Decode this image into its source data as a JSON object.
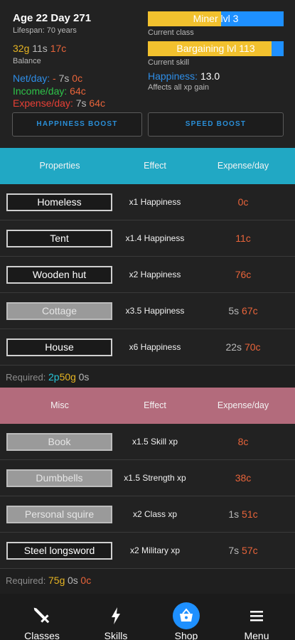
{
  "header": {
    "age": "Age 22 Day 271",
    "lifespan": "Lifespan: 70 years",
    "balance": {
      "gold": "32g",
      "silver": "11s",
      "copper": "17c"
    },
    "balance_label": "Balance",
    "net": {
      "label": "Net/day:",
      "sign": "-",
      "silver": "7s",
      "copper": "0c"
    },
    "income": {
      "label": "Income/day:",
      "copper": "64c"
    },
    "expense": {
      "label": "Expense/day:",
      "silver": "7s",
      "copper": "64c"
    },
    "class_bar": {
      "text": "Miner lvl 3",
      "progress": 0.54
    },
    "class_label": "Current class",
    "skill_bar": {
      "text": "Bargaining lvl 113",
      "progress": 0.91
    },
    "skill_label": "Current skill",
    "happiness": {
      "label": "Happiness:",
      "value": "13.0"
    },
    "happiness_note": "Affects all xp gain",
    "happiness_boost": "HAPPINESS BOOST",
    "speed_boost": "SPEED BOOST"
  },
  "properties": {
    "headers": {
      "name": "Properties",
      "effect": "Effect",
      "expense": "Expense/day"
    },
    "rows": [
      {
        "name": "Homeless",
        "effect": "x1 Happiness",
        "silver": "",
        "copper": "0c",
        "owned": false
      },
      {
        "name": "Tent",
        "effect": "x1.4 Happiness",
        "silver": "",
        "copper": "11c",
        "owned": false
      },
      {
        "name": "Wooden hut",
        "effect": "x2 Happiness",
        "silver": "",
        "copper": "76c",
        "owned": false
      },
      {
        "name": "Cottage",
        "effect": "x3.5 Happiness",
        "silver": "5s",
        "copper": "67c",
        "owned": true
      },
      {
        "name": "House",
        "effect": "x6 Happiness",
        "silver": "22s",
        "copper": "70c",
        "owned": false
      }
    ],
    "required": {
      "label": "Required:",
      "p": "2p",
      "gold": "50g",
      "silver": "0s"
    }
  },
  "misc": {
    "headers": {
      "name": "Misc",
      "effect": "Effect",
      "expense": "Expense/day"
    },
    "rows": [
      {
        "name": "Book",
        "effect": "x1.5 Skill xp",
        "silver": "",
        "copper": "8c",
        "owned": true
      },
      {
        "name": "Dumbbells",
        "effect": "x1.5 Strength xp",
        "silver": "",
        "copper": "38c",
        "owned": true
      },
      {
        "name": "Personal squire",
        "effect": "x2 Class xp",
        "silver": "1s",
        "copper": "51c",
        "owned": true
      },
      {
        "name": "Steel longsword",
        "effect": "x2 Military xp",
        "silver": "7s",
        "copper": "57c",
        "owned": false
      }
    ],
    "required": {
      "label": "Required:",
      "gold": "75g",
      "silver": "0s",
      "copper": "0c"
    }
  },
  "nav": {
    "items": [
      {
        "label": "Classes",
        "icon": "sword-icon",
        "active": false
      },
      {
        "label": "Skills",
        "icon": "lightning-icon",
        "active": false
      },
      {
        "label": "Shop",
        "icon": "basket-icon",
        "active": true
      },
      {
        "label": "Menu",
        "icon": "hamburger-menu-icon",
        "active": false
      }
    ]
  },
  "colors": {
    "properties_header": "#21a8c4",
    "misc_header": "#b36b7c",
    "gold": "#e6b422",
    "copper": "#e8643a",
    "progress_fill": "#f2c12e",
    "progress_track": "#1e90ff",
    "nav_active": "#1e90ff"
  }
}
